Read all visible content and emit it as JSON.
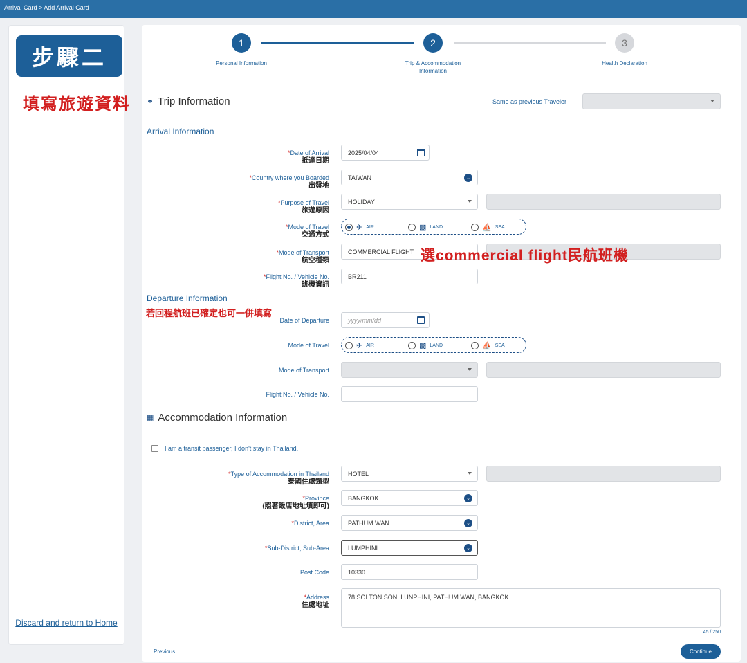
{
  "breadcrumb": "Arrival Card > Add Arrival Card",
  "overlay": {
    "step_badge": "步驟二",
    "fill_trip": "填寫旅遊資料",
    "commercial_note": "選commercial flight民航班機",
    "return_note": "若回程航班已確定也可一併填寫"
  },
  "sidebar": {
    "discard_link": "Discard and return to Home"
  },
  "stepper": {
    "steps": [
      {
        "number": "1",
        "label": "Personal Information"
      },
      {
        "number": "2",
        "label": "Trip & Accommodation Information"
      },
      {
        "number": "3",
        "label": "Health Declaration"
      }
    ]
  },
  "trip": {
    "title": "Trip Information",
    "same_as_previous_label": "Same as previous Traveler",
    "same_as_previous_value": "",
    "arrival_heading": "Arrival Information",
    "date_of_arrival": {
      "label": "Date of Arrival",
      "cn": "抵達日期",
      "value": "2025/04/04"
    },
    "country_boarded": {
      "label": "Country where you Boarded",
      "cn": "出發地",
      "value": "TAIWAN"
    },
    "purpose": {
      "label": "Purpose of Travel",
      "cn": "旅遊原因",
      "value": "HOLIDAY"
    },
    "mode_travel": {
      "label": "Mode of Travel",
      "cn": "交通方式",
      "options": [
        "AIR",
        "LAND",
        "SEA"
      ],
      "selected": "AIR"
    },
    "mode_transport": {
      "label": "Mode of Transport",
      "cn": "航空種類",
      "value": "COMMERCIAL FLIGHT"
    },
    "flight_no": {
      "label": "Flight No. / Vehicle No.",
      "cn": "班機資訊",
      "value": "BR211"
    },
    "departure_heading": "Departure Information",
    "date_of_departure": {
      "label": "Date of Departure",
      "placeholder": "yyyy/mm/dd"
    },
    "dep_mode_travel": {
      "label": "Mode of Travel",
      "options": [
        "AIR",
        "LAND",
        "SEA"
      ]
    },
    "dep_mode_transport": {
      "label": "Mode of Transport"
    },
    "dep_flight_no": {
      "label": "Flight No. / Vehicle No."
    }
  },
  "accommodation": {
    "title": "Accommodation Information",
    "transit_checkbox": "I am a transit passenger, I don't stay in Thailand.",
    "type": {
      "label": "Type of Accommodation in Thailand",
      "cn": "泰國住處類型",
      "value": "HOTEL"
    },
    "province": {
      "label": "Province",
      "cn": "(照著飯店地址填即可)",
      "value": "BANGKOK"
    },
    "district": {
      "label": "District, Area",
      "value": "PATHUM WAN"
    },
    "subdistrict": {
      "label": "Sub-District, Sub-Area",
      "value": "LUMPHINI"
    },
    "post_code": {
      "label": "Post Code",
      "value": "10330"
    },
    "address": {
      "label": "Address",
      "cn": "住處地址",
      "value": "78 SOI TON SON, LUNPHINI, PATHUM WAN, BANGKOK",
      "counter": "45 / 250"
    }
  },
  "footer": {
    "previous": "Previous",
    "continue": "Continue"
  },
  "colors": {
    "primary": "#1d5f98",
    "topbar": "#2a6fa6",
    "annotation": "#d21f1f"
  }
}
